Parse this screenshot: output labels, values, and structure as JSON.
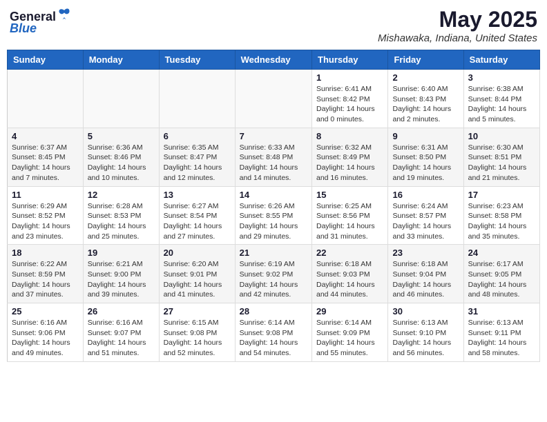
{
  "logo": {
    "general": "General",
    "blue": "Blue"
  },
  "title": {
    "month_year": "May 2025",
    "location": "Mishawaka, Indiana, United States"
  },
  "days": [
    "Sunday",
    "Monday",
    "Tuesday",
    "Wednesday",
    "Thursday",
    "Friday",
    "Saturday"
  ],
  "weeks": [
    [
      {
        "day": "",
        "text": ""
      },
      {
        "day": "",
        "text": ""
      },
      {
        "day": "",
        "text": ""
      },
      {
        "day": "",
        "text": ""
      },
      {
        "day": "1",
        "text": "Sunrise: 6:41 AM\nSunset: 8:42 PM\nDaylight: 14 hours and 0 minutes."
      },
      {
        "day": "2",
        "text": "Sunrise: 6:40 AM\nSunset: 8:43 PM\nDaylight: 14 hours and 2 minutes."
      },
      {
        "day": "3",
        "text": "Sunrise: 6:38 AM\nSunset: 8:44 PM\nDaylight: 14 hours and 5 minutes."
      }
    ],
    [
      {
        "day": "4",
        "text": "Sunrise: 6:37 AM\nSunset: 8:45 PM\nDaylight: 14 hours and 7 minutes."
      },
      {
        "day": "5",
        "text": "Sunrise: 6:36 AM\nSunset: 8:46 PM\nDaylight: 14 hours and 10 minutes."
      },
      {
        "day": "6",
        "text": "Sunrise: 6:35 AM\nSunset: 8:47 PM\nDaylight: 14 hours and 12 minutes."
      },
      {
        "day": "7",
        "text": "Sunrise: 6:33 AM\nSunset: 8:48 PM\nDaylight: 14 hours and 14 minutes."
      },
      {
        "day": "8",
        "text": "Sunrise: 6:32 AM\nSunset: 8:49 PM\nDaylight: 14 hours and 16 minutes."
      },
      {
        "day": "9",
        "text": "Sunrise: 6:31 AM\nSunset: 8:50 PM\nDaylight: 14 hours and 19 minutes."
      },
      {
        "day": "10",
        "text": "Sunrise: 6:30 AM\nSunset: 8:51 PM\nDaylight: 14 hours and 21 minutes."
      }
    ],
    [
      {
        "day": "11",
        "text": "Sunrise: 6:29 AM\nSunset: 8:52 PM\nDaylight: 14 hours and 23 minutes."
      },
      {
        "day": "12",
        "text": "Sunrise: 6:28 AM\nSunset: 8:53 PM\nDaylight: 14 hours and 25 minutes."
      },
      {
        "day": "13",
        "text": "Sunrise: 6:27 AM\nSunset: 8:54 PM\nDaylight: 14 hours and 27 minutes."
      },
      {
        "day": "14",
        "text": "Sunrise: 6:26 AM\nSunset: 8:55 PM\nDaylight: 14 hours and 29 minutes."
      },
      {
        "day": "15",
        "text": "Sunrise: 6:25 AM\nSunset: 8:56 PM\nDaylight: 14 hours and 31 minutes."
      },
      {
        "day": "16",
        "text": "Sunrise: 6:24 AM\nSunset: 8:57 PM\nDaylight: 14 hours and 33 minutes."
      },
      {
        "day": "17",
        "text": "Sunrise: 6:23 AM\nSunset: 8:58 PM\nDaylight: 14 hours and 35 minutes."
      }
    ],
    [
      {
        "day": "18",
        "text": "Sunrise: 6:22 AM\nSunset: 8:59 PM\nDaylight: 14 hours and 37 minutes."
      },
      {
        "day": "19",
        "text": "Sunrise: 6:21 AM\nSunset: 9:00 PM\nDaylight: 14 hours and 39 minutes."
      },
      {
        "day": "20",
        "text": "Sunrise: 6:20 AM\nSunset: 9:01 PM\nDaylight: 14 hours and 41 minutes."
      },
      {
        "day": "21",
        "text": "Sunrise: 6:19 AM\nSunset: 9:02 PM\nDaylight: 14 hours and 42 minutes."
      },
      {
        "day": "22",
        "text": "Sunrise: 6:18 AM\nSunset: 9:03 PM\nDaylight: 14 hours and 44 minutes."
      },
      {
        "day": "23",
        "text": "Sunrise: 6:18 AM\nSunset: 9:04 PM\nDaylight: 14 hours and 46 minutes."
      },
      {
        "day": "24",
        "text": "Sunrise: 6:17 AM\nSunset: 9:05 PM\nDaylight: 14 hours and 48 minutes."
      }
    ],
    [
      {
        "day": "25",
        "text": "Sunrise: 6:16 AM\nSunset: 9:06 PM\nDaylight: 14 hours and 49 minutes."
      },
      {
        "day": "26",
        "text": "Sunrise: 6:16 AM\nSunset: 9:07 PM\nDaylight: 14 hours and 51 minutes."
      },
      {
        "day": "27",
        "text": "Sunrise: 6:15 AM\nSunset: 9:08 PM\nDaylight: 14 hours and 52 minutes."
      },
      {
        "day": "28",
        "text": "Sunrise: 6:14 AM\nSunset: 9:08 PM\nDaylight: 14 hours and 54 minutes."
      },
      {
        "day": "29",
        "text": "Sunrise: 6:14 AM\nSunset: 9:09 PM\nDaylight: 14 hours and 55 minutes."
      },
      {
        "day": "30",
        "text": "Sunrise: 6:13 AM\nSunset: 9:10 PM\nDaylight: 14 hours and 56 minutes."
      },
      {
        "day": "31",
        "text": "Sunrise: 6:13 AM\nSunset: 9:11 PM\nDaylight: 14 hours and 58 minutes."
      }
    ]
  ]
}
